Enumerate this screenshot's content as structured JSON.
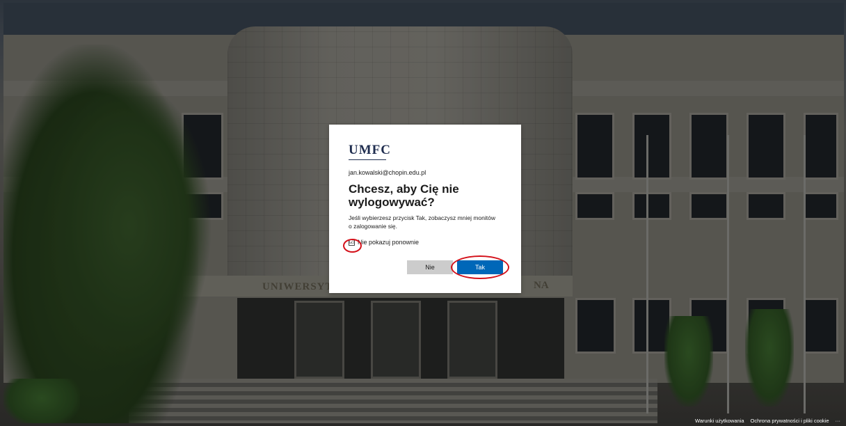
{
  "background": {
    "building_sign_left": "UNIWERSYT",
    "building_sign_right": "NA"
  },
  "dialog": {
    "logo": "UMFC",
    "identity": "jan.kowalski@chopin.edu.pl",
    "title": "Chcesz, aby Cię nie wylogowywać?",
    "description": "Jeśli wybierzesz przycisk Tak, zobaczysz mniej monitów o zalogowanie się.",
    "checkbox_label": "Nie pokazuj ponownie",
    "checkbox_checked": true,
    "checkbox_glyph": "☑",
    "no_button": "Nie",
    "yes_button": "Tak",
    "accent_color": "#0067b8"
  },
  "footer": {
    "terms": "Warunki użytkowania",
    "privacy": "Ochrona prywatności i pliki cookie",
    "more": "···"
  }
}
